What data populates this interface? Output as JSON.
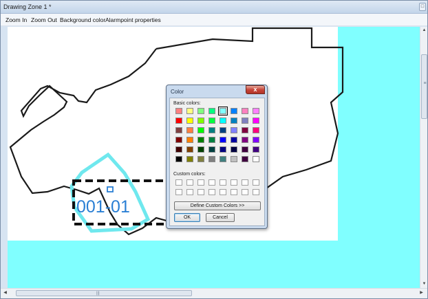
{
  "window": {
    "title": "Drawing Zone 1 *",
    "restore_glyph": "□"
  },
  "menu": {
    "items": [
      "Zoom In",
      "Zoom Out",
      "Background color",
      "Alarmpoint properties"
    ]
  },
  "canvas": {
    "background_color": "#80ffff",
    "sheet_color": "#ffffff",
    "alarm_label": "001-01",
    "alarm_label_color": "#2a7fd4",
    "zone_highlight_color": "#6fe8ee"
  },
  "color_dialog": {
    "title": "Color",
    "close_glyph": "x",
    "basic_colors_label": "Basic colors:",
    "custom_colors_label": "Custom colors:",
    "define_custom_button": "Define Custom Colors >>",
    "ok_button": "OK",
    "cancel_button": "Cancel",
    "selected_color": "#80ffff",
    "basic_colors": [
      [
        "#ff8080",
        "#ffff80",
        "#80ff80",
        "#00ff80",
        "#80ffff",
        "#0080ff",
        "#ff80c0",
        "#ff80ff"
      ],
      [
        "#ff0000",
        "#ffff00",
        "#80ff00",
        "#00ff40",
        "#00ffff",
        "#0080c0",
        "#8080c0",
        "#ff00ff"
      ],
      [
        "#804040",
        "#ff8040",
        "#00ff00",
        "#008080",
        "#004080",
        "#8080ff",
        "#800040",
        "#ff0080"
      ],
      [
        "#800000",
        "#ff8000",
        "#008000",
        "#008040",
        "#0000ff",
        "#0000a0",
        "#800080",
        "#8000ff"
      ],
      [
        "#400000",
        "#804000",
        "#004000",
        "#004040",
        "#000080",
        "#000040",
        "#400040",
        "#400080"
      ],
      [
        "#000000",
        "#808000",
        "#808040",
        "#808080",
        "#408080",
        "#c0c0c0",
        "#400040",
        "#ffffff"
      ]
    ]
  },
  "scrollbars": {
    "up_arrow": "▲",
    "down_arrow": "▼",
    "left_arrow": "◀",
    "right_arrow": "▶",
    "grip": "≡",
    "hgrip": "|||"
  }
}
